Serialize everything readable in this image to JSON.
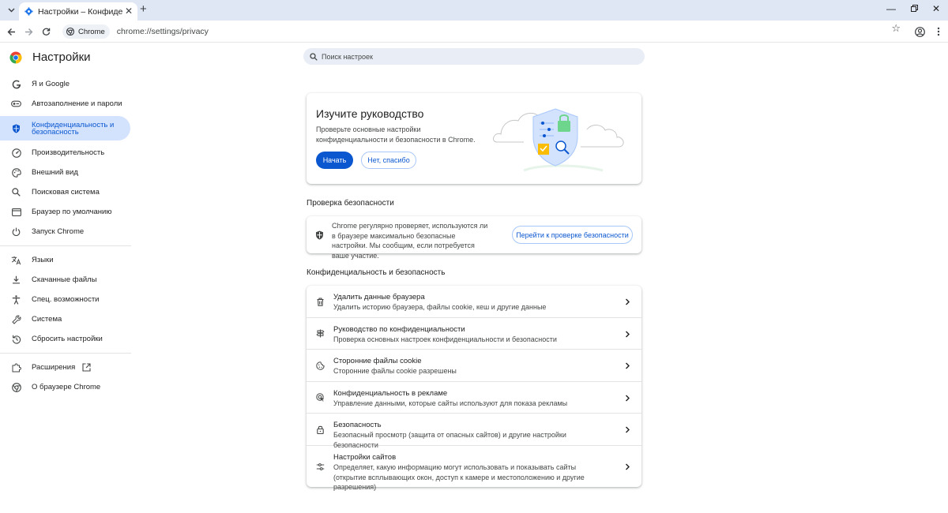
{
  "browser": {
    "tab_title": "Настройки – Конфиденциальность и безопасность",
    "chip_label": "Chrome",
    "url": "chrome://settings/privacy"
  },
  "app": {
    "title": "Настройки",
    "search_placeholder": "Поиск настроек"
  },
  "sidebar": {
    "items": [
      {
        "label": "Я и Google",
        "icon": "google-g-icon"
      },
      {
        "label": "Автозаполнение и пароли",
        "icon": "key-icon"
      },
      {
        "label": "Конфиденциальность и безопасность",
        "icon": "shield-icon",
        "active": true
      },
      {
        "label": "Производительность",
        "icon": "speedometer-icon"
      },
      {
        "label": "Внешний вид",
        "icon": "palette-icon"
      },
      {
        "label": "Поисковая система",
        "icon": "search-icon"
      },
      {
        "label": "Браузер по умолчанию",
        "icon": "browser-window-icon"
      },
      {
        "label": "Запуск Chrome",
        "icon": "power-icon"
      },
      {
        "label": "Языки",
        "icon": "translate-icon"
      },
      {
        "label": "Скачанные файлы",
        "icon": "download-icon"
      },
      {
        "label": "Спец. возможности",
        "icon": "accessibility-icon"
      },
      {
        "label": "Система",
        "icon": "wrench-icon"
      },
      {
        "label": "Сбросить настройки",
        "icon": "reset-icon"
      },
      {
        "label": "Расширения",
        "icon": "puzzle-icon"
      },
      {
        "label": "О браузере Chrome",
        "icon": "chrome-icon"
      }
    ]
  },
  "guide": {
    "title": "Изучите руководство",
    "description": "Проверьте основные настройки конфиденциальности и безопасности в Chrome.",
    "start_label": "Начать",
    "no_thanks_label": "Нет, спасибо"
  },
  "safety_check": {
    "section_title": "Проверка безопасности",
    "text": "Chrome регулярно проверяет, используются ли в браузере максимально безопасные настройки. Мы сообщим, если потребуется ваше участие.",
    "button_label": "Перейти к проверке безопасности"
  },
  "privacy": {
    "section_title": "Конфиденциальность и безопасность",
    "rows": [
      {
        "title": "Удалить данные браузера",
        "subtitle": "Удалить историю браузера, файлы cookie, кеш и другие данные",
        "icon": "trash-icon"
      },
      {
        "title": "Руководство по конфиденциальности",
        "subtitle": "Проверка основных настроек конфиденциальности и безопасности",
        "icon": "signpost-icon"
      },
      {
        "title": "Сторонние файлы cookie",
        "subtitle": "Сторонние файлы cookie разрешены",
        "icon": "cookie-icon"
      },
      {
        "title": "Конфиденциальность в рекламе",
        "subtitle": "Управление данными, которые сайты используют для показа рекламы",
        "icon": "ad-privacy-icon"
      },
      {
        "title": "Безопасность",
        "subtitle": "Безопасный просмотр (защита от опасных сайтов) и другие настройки безопасности",
        "icon": "lock-icon"
      },
      {
        "title": "Настройки сайтов",
        "subtitle": "Определяет, какую информацию могут использовать и показывать сайты (открытие всплывающих окон, доступ к камере и местоположению и другие разрешения)",
        "icon": "sliders-icon"
      }
    ]
  },
  "colors": {
    "accent": "#0b57d0",
    "active_bg": "#d3e3fd",
    "titlebar": "#dfe7f4"
  }
}
